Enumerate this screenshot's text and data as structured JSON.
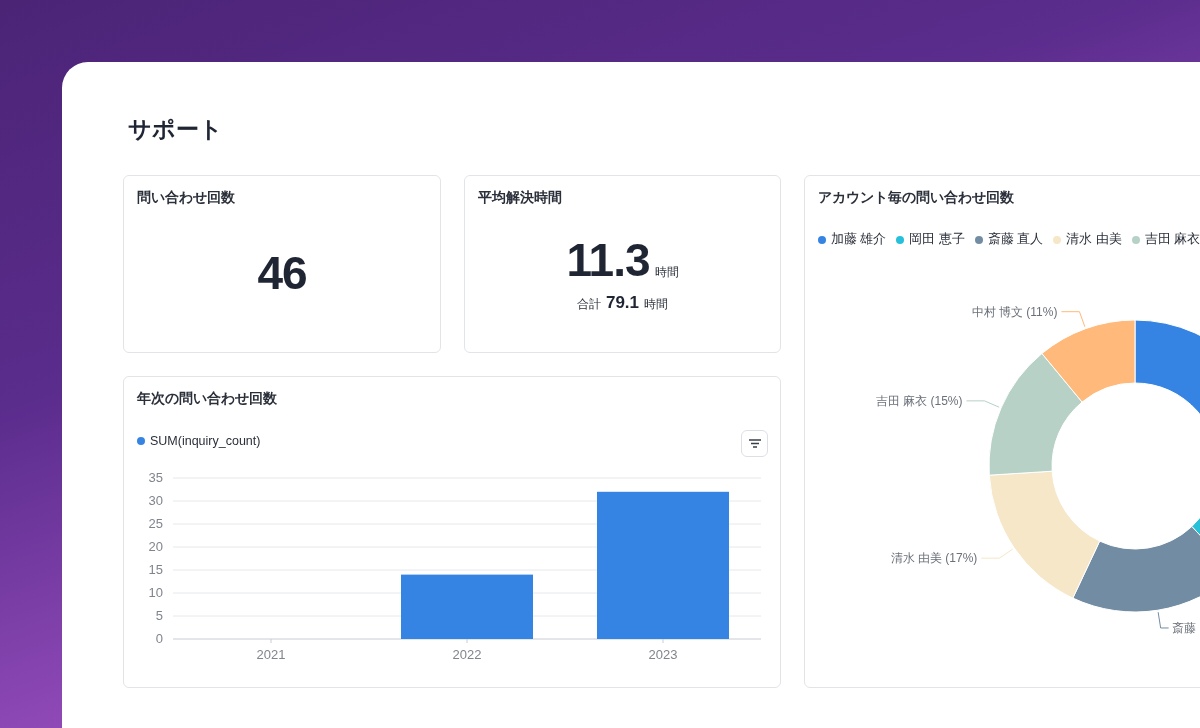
{
  "page": {
    "title": "サポート"
  },
  "inquiry_count": {
    "title": "問い合わせ回数",
    "value": "46"
  },
  "avg_resolution": {
    "title": "平均解決時間",
    "value": "11.3",
    "unit": "時間",
    "total_label": "合計",
    "total_value": "79.1",
    "total_unit": "時間"
  },
  "yearly_chart": {
    "title": "年次の問い合わせ回数",
    "chart_data": {
      "type": "bar",
      "categories": [
        "2021",
        "2022",
        "2023"
      ],
      "series": [
        {
          "name": "SUM(inquiry_count)",
          "color": "#3584e4",
          "values": [
            0,
            14,
            32
          ]
        }
      ],
      "ylim": [
        0,
        35
      ],
      "grid": true,
      "yticks": [
        0,
        5,
        10,
        15,
        20,
        25,
        30,
        35
      ]
    }
  },
  "account_chart": {
    "title": "アカウント毎の問い合わせ回数",
    "chart_data": {
      "type": "donut",
      "categories": [
        "加藤 雄介",
        "岡田 恵子",
        "斎藤 直人",
        "清水 由美",
        "吉田 麻衣",
        "中村 博文"
      ],
      "values": [
        27,
        11,
        19,
        17,
        15,
        11
      ],
      "colors": [
        "#3584e4",
        "#26c0d9",
        "#728da3",
        "#f5e7c8",
        "#b7d1c6",
        "#ffb97a"
      ]
    },
    "slice_labels": [
      {
        "kind": "named",
        "share": "(11%)"
      },
      {
        "kind": "named",
        "share": "(15%)"
      },
      {
        "kind": "named",
        "share": "(17%)"
      },
      {
        "kind": "cut",
        "text": "斎藤"
      }
    ]
  }
}
